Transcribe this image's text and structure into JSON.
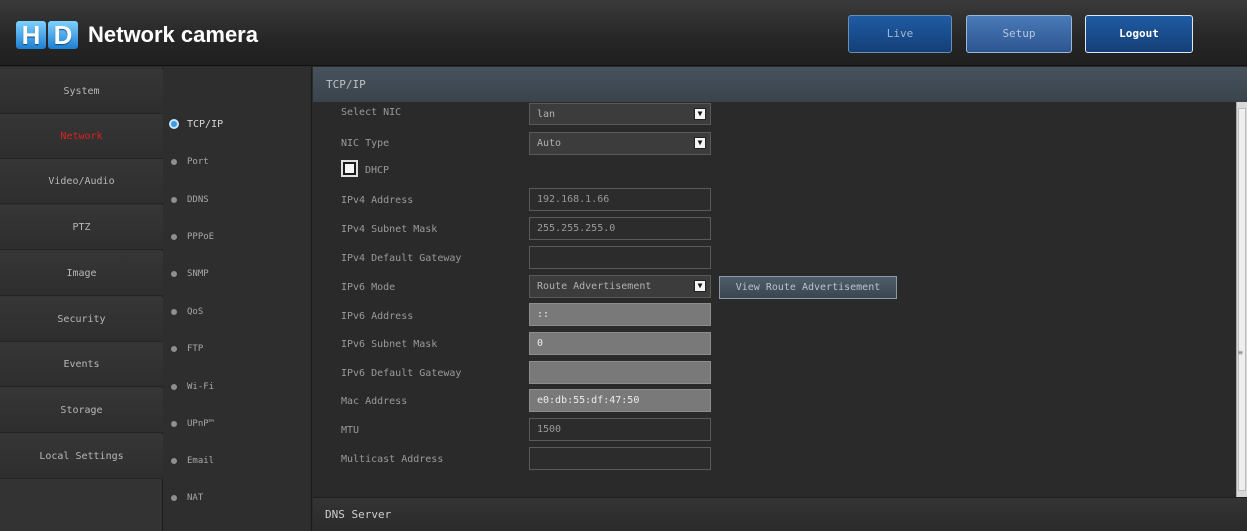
{
  "header": {
    "logo_mark": "HD",
    "logo_text": "Network camera",
    "buttons": {
      "live": "Live",
      "setup": "Setup",
      "logout": "Logout"
    }
  },
  "main_nav": [
    {
      "label": "System",
      "active": false
    },
    {
      "label": "Network",
      "active": true
    },
    {
      "label": "Video/Audio",
      "active": false
    },
    {
      "label": "PTZ",
      "active": false
    },
    {
      "label": "Image",
      "active": false
    },
    {
      "label": "Security",
      "active": false
    },
    {
      "label": "Events",
      "active": false
    },
    {
      "label": "Storage",
      "active": false
    },
    {
      "label": "Local Settings",
      "active": false
    }
  ],
  "sub_nav": [
    {
      "label": "TCP/IP",
      "active": true
    },
    {
      "label": "Port",
      "active": false
    },
    {
      "label": "DDNS",
      "active": false
    },
    {
      "label": "PPPoE",
      "active": false
    },
    {
      "label": "SNMP",
      "active": false
    },
    {
      "label": "QoS",
      "active": false
    },
    {
      "label": "FTP",
      "active": false
    },
    {
      "label": "Wi-Fi",
      "active": false
    },
    {
      "label": "UPnP™",
      "active": false
    },
    {
      "label": "Email",
      "active": false
    },
    {
      "label": "NAT",
      "active": false
    }
  ],
  "content": {
    "section_title": "TCP/IP",
    "fields": {
      "select_nic": {
        "label": "Select NIC",
        "value": "lan"
      },
      "nic_type": {
        "label": "NIC Type",
        "value": "Auto"
      },
      "dhcp": {
        "label": "DHCP",
        "checked": false
      },
      "ipv4_address": {
        "label": "IPv4 Address",
        "value": "192.168.1.66"
      },
      "ipv4_mask": {
        "label": "IPv4 Subnet Mask",
        "value": "255.255.255.0"
      },
      "ipv4_gateway": {
        "label": "IPv4 Default Gateway",
        "value": ""
      },
      "ipv6_mode": {
        "label": "IPv6 Mode",
        "value": "Route Advertisement"
      },
      "ipv6_address": {
        "label": "IPv6 Address",
        "value": "::"
      },
      "ipv6_mask": {
        "label": "IPv6 Subnet Mask",
        "value": "0"
      },
      "ipv6_gateway": {
        "label": "IPv6 Default Gateway",
        "value": ""
      },
      "mac_address": {
        "label": "Mac Address",
        "value": "e0:db:55:df:47:50"
      },
      "mtu": {
        "label": "MTU",
        "value": "1500"
      },
      "multicast": {
        "label": "Multicast Address",
        "value": ""
      }
    },
    "view_route_button": "View Route Advertisement",
    "dns_title": "DNS Server"
  },
  "colors": {
    "accent_blue": "#1f5ba3",
    "active_nav_red": "#e02020",
    "active_dot_blue": "#3a9be8"
  }
}
